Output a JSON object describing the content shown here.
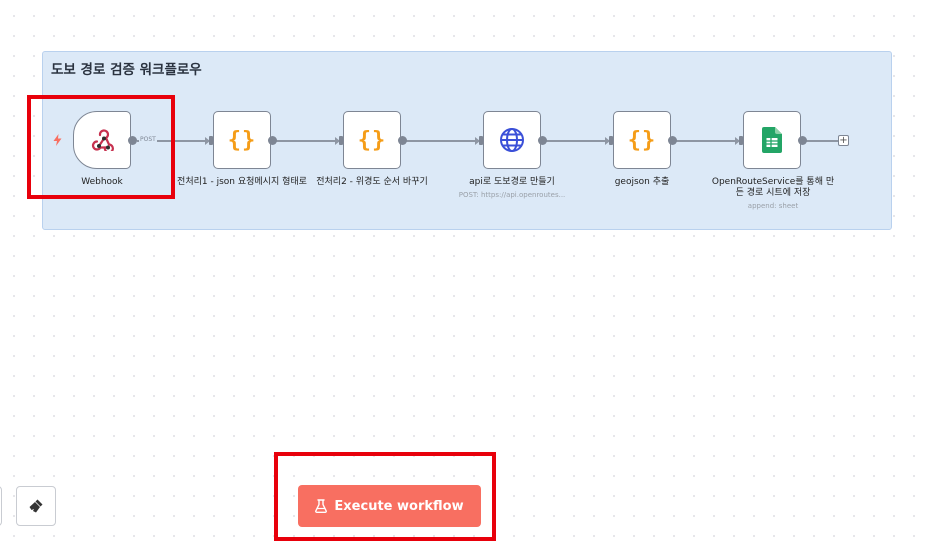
{
  "workflow": {
    "sticky_title": "도보 경로 검증 워크플로우",
    "webhook_method": "POST",
    "nodes": [
      {
        "label": "Webhook",
        "subtitle": "",
        "icon": "webhook-icon"
      },
      {
        "label": "전처리1 - json 요청메시지 형태로",
        "subtitle": "",
        "icon": "code-braces-icon"
      },
      {
        "label": "전처리2 - 위경도 순서 바꾸기",
        "subtitle": "",
        "icon": "code-braces-icon"
      },
      {
        "label": "api로 도보경로 만들기",
        "subtitle": "POST: https://api.openroutes...",
        "icon": "globe-icon"
      },
      {
        "label": "geojson 추출",
        "subtitle": "",
        "icon": "code-braces-icon"
      },
      {
        "label": "OpenRouteService를 통해 만든 경로 시트에 저장",
        "subtitle": "append: sheet",
        "icon": "google-sheets-icon"
      }
    ],
    "code_glyph": "{}",
    "add_node_glyph": "+"
  },
  "toolbar": {
    "execute_label": "Execute workflow"
  },
  "colors": {
    "accent": "#f86f61",
    "sticky_bg": "#dce9f7",
    "highlight": "#e8000b",
    "code_orange": "#f59d18",
    "globe_blue": "#3b50d8",
    "sheets_green": "#23a566"
  }
}
